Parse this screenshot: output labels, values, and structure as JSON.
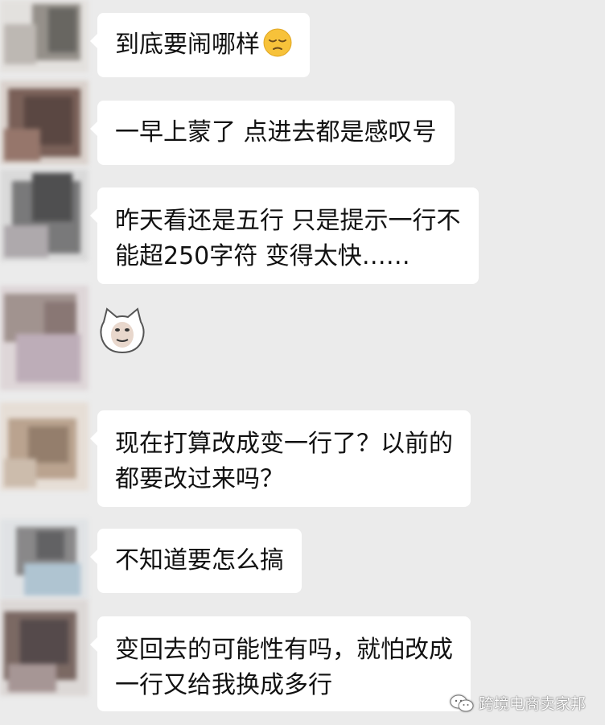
{
  "messages": [
    {
      "type": "text",
      "lines": [
        "到底要闹哪样"
      ],
      "emoji": "pensive-face-emoji"
    },
    {
      "type": "text",
      "lines": [
        "一早上蒙了 点进去都是感叹号"
      ]
    },
    {
      "type": "text",
      "lines": [
        "昨天看还是五行 只是提示一行不",
        "能超250字符 变得太快……"
      ]
    },
    {
      "type": "sticker",
      "sticker": "cat-face-sticker"
    },
    {
      "type": "text",
      "lines": [
        "现在打算改成变一行了？以前的",
        "都要改过来吗？"
      ]
    },
    {
      "type": "text",
      "lines": [
        "不知道要怎么搞"
      ]
    },
    {
      "type": "text",
      "lines": [
        "变回去的可能性有吗，就怕改成",
        "一行又给我换成多行"
      ]
    }
  ],
  "watermark": {
    "text": "跨境电商卖家邦",
    "icon": "wechat-icon"
  },
  "colors": {
    "background": "#ebebeb",
    "bubble": "#ffffff",
    "text": "#111111"
  }
}
